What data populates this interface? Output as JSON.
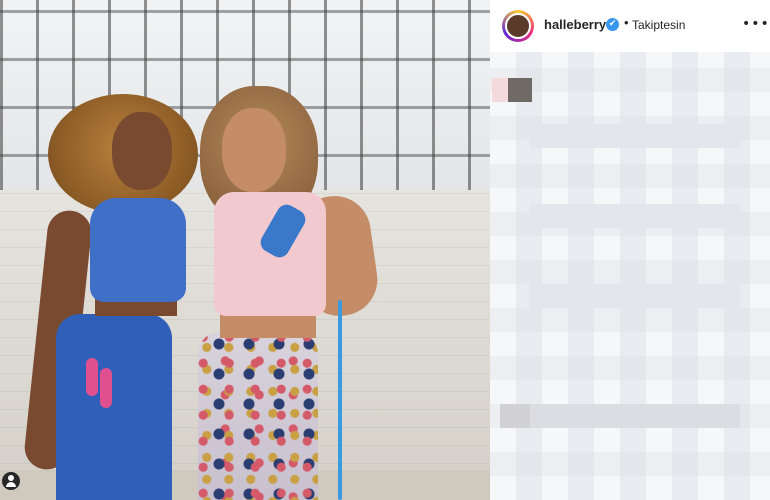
{
  "post": {
    "username": "halleberry",
    "verified_mark": "✔",
    "separator": "•",
    "follow_status": "Takiptesin",
    "more_label": "•••"
  },
  "icons": {
    "verified": "verified-badge-icon",
    "more": "more-options-icon",
    "tagged_users": "user-tag-icon"
  },
  "colors": {
    "accent_blue": "#3897f0",
    "text": "#262626"
  }
}
